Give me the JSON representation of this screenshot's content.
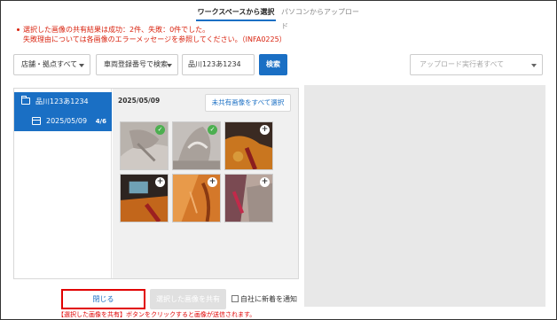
{
  "tabs": {
    "active": "ワークスペースから選択",
    "inactive": "パソコンからアップロード"
  },
  "errors": {
    "line1": "選択した画像の共有結果は成功：2件、失敗：0件でした。",
    "line2": "失敗理由については各画像のエラーメッセージを参照してください。（INFA0225）"
  },
  "filters": {
    "store": "店舗・拠点すべて",
    "search_type": "車両登録番号で検索",
    "plate_value": "品川123あ1234",
    "search_button": "検索",
    "uploader_placeholder": "アップロード実行者すべて"
  },
  "tree": {
    "vehicle": "品川123あ1234",
    "date": "2025/05/09",
    "count": "4/6"
  },
  "gallery": {
    "date": "2025/05/09",
    "select_unshared": "未共有画像をすべて選択",
    "thumbnails": [
      {
        "badge": "check",
        "badge_glyph": "✓"
      },
      {
        "badge": "check",
        "badge_glyph": "✓"
      },
      {
        "badge": "plus",
        "badge_glyph": "+"
      },
      {
        "badge": "plus",
        "badge_glyph": "+"
      },
      {
        "badge": "plus",
        "badge_glyph": "+"
      },
      {
        "badge": "plus",
        "badge_glyph": "+"
      }
    ]
  },
  "footer": {
    "close": "閉じる",
    "share": "選択した画像を共有",
    "notify": "自社に新着を通知",
    "hint": "【選択した画像を共有】ボタンをクリックすると画像が送信されます。"
  },
  "colors": {
    "accent": "#1a6fc4",
    "error": "#d9230f",
    "highlight": "#e10000",
    "success": "#4caf50"
  }
}
